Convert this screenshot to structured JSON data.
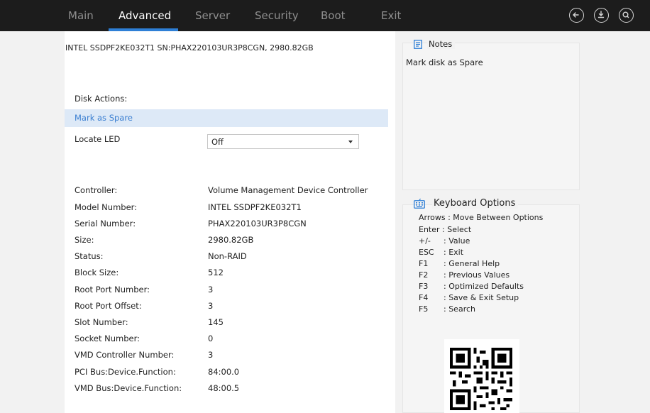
{
  "nav": {
    "tabs": [
      {
        "label": "Main"
      },
      {
        "label": "Advanced"
      },
      {
        "label": "Server"
      },
      {
        "label": "Security"
      },
      {
        "label": "Boot"
      },
      {
        "label": "Exit"
      }
    ],
    "active_tab": "Advanced",
    "icons": [
      "back-icon",
      "save-icon",
      "search-icon"
    ],
    "accent_color": "#2e7fd6"
  },
  "disk": {
    "title": "INTEL SSDPF2KE032T1 SN:PHAX220103UR3P8CGN, 2980.82GB",
    "actions_label": "Disk Actions:",
    "mark_spare_label": "Mark as Spare",
    "locate_led_label": "Locate LED",
    "locate_led_value": "Off"
  },
  "details": [
    {
      "label": "Controller:",
      "value": "Volume Management Device Controller"
    },
    {
      "label": "Model Number:",
      "value": "INTEL SSDPF2KE032T1"
    },
    {
      "label": "Serial Number:",
      "value": "PHAX220103UR3P8CGN"
    },
    {
      "label": "Size:",
      "value": "2980.82GB"
    },
    {
      "label": "Status:",
      "value": "Non-RAID"
    },
    {
      "label": "Block Size:",
      "value": "512"
    },
    {
      "label": "Root Port Number:",
      "value": "3"
    },
    {
      "label": "Root Port Offset:",
      "value": "3"
    },
    {
      "label": "Slot Number:",
      "value": "145"
    },
    {
      "label": "Socket Number:",
      "value": "0"
    },
    {
      "label": "VMD Controller Number:",
      "value": "3"
    },
    {
      "label": "PCI Bus:Device.Function:",
      "value": "84:00.0"
    },
    {
      "label": "VMD Bus:Device.Function:",
      "value": "48:00.5"
    }
  ],
  "notes": {
    "title": "Notes",
    "body": "Mark disk as Spare"
  },
  "keyboard": {
    "title": "Keyboard Options",
    "options": [
      {
        "text": "Arrows : Move Between Options"
      },
      {
        "text": "Enter   : Select"
      },
      {
        "key": "+/-",
        "desc": ": Value"
      },
      {
        "key": "ESC",
        "desc": ": Exit"
      },
      {
        "key": "F1",
        "desc": ": General Help"
      },
      {
        "key": "F2",
        "desc": ": Previous Values"
      },
      {
        "key": "F3",
        "desc": ": Optimized Defaults"
      },
      {
        "key": "F4",
        "desc": ": Save & Exit Setup"
      },
      {
        "key": "F5",
        "desc": ": Search"
      }
    ]
  }
}
